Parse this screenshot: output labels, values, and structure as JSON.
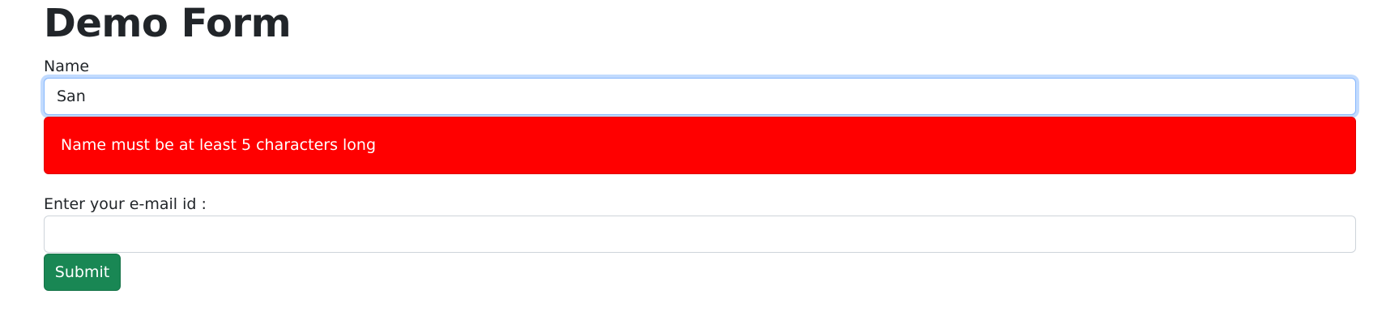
{
  "form": {
    "title": "Demo Form",
    "name_label": "Name",
    "name_value": "San",
    "error_message": "Name must be at least 5 characters long",
    "email_label": "Enter your e-mail id :",
    "email_value": "",
    "submit_label": "Submit"
  },
  "colors": {
    "error_background": "#ff0000",
    "submit_background": "#198754",
    "focus_border": "#86b7fe"
  }
}
